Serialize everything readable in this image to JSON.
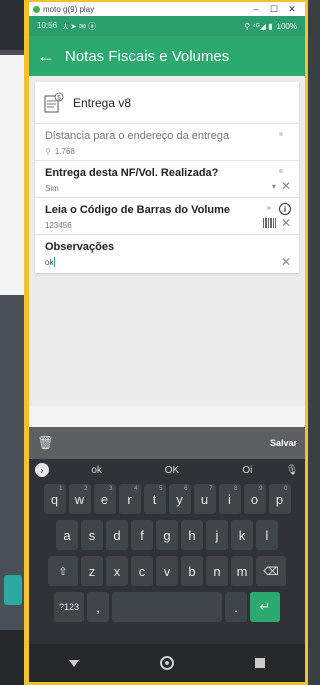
{
  "titlebar": {
    "title": "moto g(9) play",
    "minimize": "–",
    "maximize": "☐",
    "close": "✕"
  },
  "statusbar": {
    "time": "10:56",
    "icons_left": "⅄ ➤ ✉ ⓐ",
    "icons_right": "⚲ ⁴ᴳ◢ ▮",
    "battery": "100%"
  },
  "appbar": {
    "back": "←",
    "title": "Notas Fiscais e Volumes"
  },
  "card": {
    "title": "Entrega v8",
    "fields": [
      {
        "label": "Distancia para o endereço da entrega",
        "value": "1.768"
      },
      {
        "label": "Entrega desta NF/Vol. Realizada?",
        "value": "Sim"
      },
      {
        "label": "Leia o Código de Barras do Volume",
        "value": "123456",
        "info": "i"
      },
      {
        "label": "Observações",
        "value": "ok"
      }
    ]
  },
  "toolbar": {
    "save_label": "Salvar"
  },
  "keyboard": {
    "suggestions": [
      "ok",
      "OK",
      "Oi"
    ],
    "row1": [
      "q",
      "w",
      "e",
      "r",
      "t",
      "y",
      "u",
      "i",
      "o",
      "p"
    ],
    "row1_num": [
      "1",
      "2",
      "3",
      "4",
      "5",
      "6",
      "7",
      "8",
      "9",
      "0"
    ],
    "row2": [
      "a",
      "s",
      "d",
      "f",
      "g",
      "h",
      "j",
      "k",
      "l"
    ],
    "row3": [
      "z",
      "x",
      "c",
      "v",
      "b",
      "n",
      "m"
    ],
    "symbols_label": "?123",
    "comma": ","
  }
}
